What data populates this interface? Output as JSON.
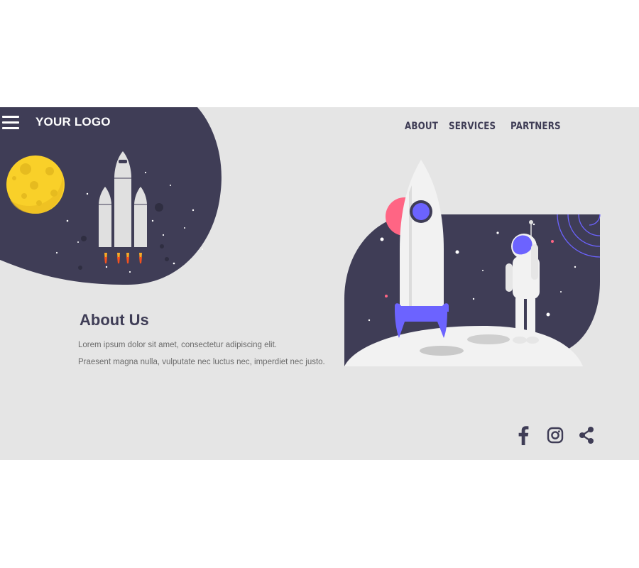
{
  "header": {
    "logo_text": "YOUR LOGO",
    "nav": [
      {
        "label": "ABOUT"
      },
      {
        "label": "SERVICES"
      },
      {
        "label": "PARTNERS"
      }
    ]
  },
  "main": {
    "heading": "About Us",
    "paragraphs": [
      "Lorem ipsum dolor sit amet, consectetur adipiscing elit.",
      "Praesent magna nulla, vulputate nec luctus nec, imperdiet nec justo."
    ]
  },
  "social": [
    {
      "icon": "facebook-icon"
    },
    {
      "icon": "instagram-icon"
    },
    {
      "icon": "share-icon"
    }
  ],
  "colors": {
    "background": "#e5e5e5",
    "dark": "#3f3d56",
    "accent": "#6c63ff",
    "moon": "#f9d029",
    "pink": "#ff6584",
    "text_muted": "#6b6b6b"
  }
}
